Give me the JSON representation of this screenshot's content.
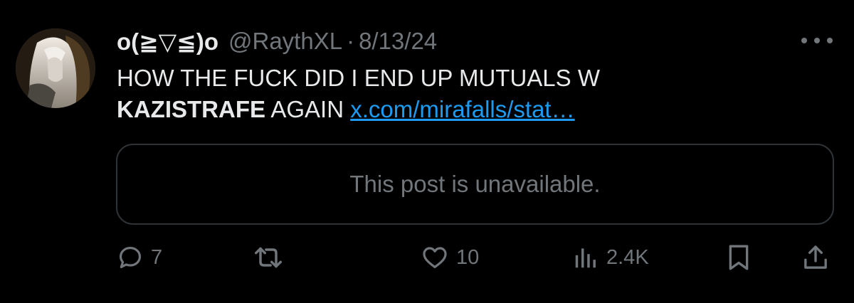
{
  "colors": {
    "background": "#000000",
    "text_primary": "#e7e9ea",
    "text_secondary": "#71767b",
    "link": "#1d9bf0",
    "border": "#2f3336"
  },
  "post": {
    "author": {
      "display_name": "o(≧▽≦)o",
      "handle": "@RaythXL",
      "separator": "·",
      "timestamp": "8/13/24"
    },
    "text": {
      "line1": "HOW THE FUCK DID I END UP MUTUALS W",
      "bold_word": "KAZISTRAFE",
      "after_bold": " AGAIN ",
      "link": "x.com/mirafalls/stat…"
    },
    "quote": {
      "message": "This post is unavailable."
    },
    "actions": {
      "replies": "7",
      "reposts": "",
      "likes": "10",
      "views": "2.4K"
    },
    "icons": [
      "avatar",
      "more-icon",
      "reply-icon",
      "repost-icon",
      "like-icon",
      "views-icon",
      "bookmark-icon",
      "share-icon"
    ]
  }
}
